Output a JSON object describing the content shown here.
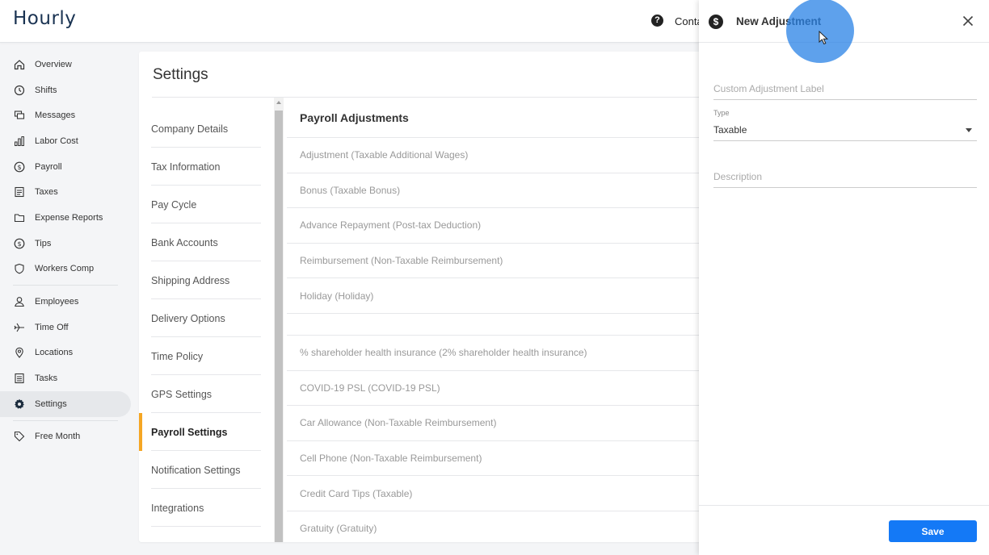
{
  "app": {
    "name": "Hourly"
  },
  "topbar": {
    "help_icon": "question-circle-icon",
    "contact_label": "Contact"
  },
  "nav": {
    "items": [
      {
        "label": "Overview",
        "icon": "home-icon"
      },
      {
        "label": "Shifts",
        "icon": "clock-icon"
      },
      {
        "label": "Messages",
        "icon": "chat-icon"
      },
      {
        "label": "Labor Cost",
        "icon": "bar-chart-icon"
      },
      {
        "label": "Payroll",
        "icon": "dollar-circle-icon"
      },
      {
        "label": "Taxes",
        "icon": "document-icon"
      },
      {
        "label": "Expense Reports",
        "icon": "folder-icon"
      },
      {
        "label": "Tips",
        "icon": "dollar-circle-icon"
      },
      {
        "label": "Workers Comp",
        "icon": "shield-icon"
      },
      {
        "label": "Employees",
        "icon": "person-icon"
      },
      {
        "label": "Time Off",
        "icon": "plane-icon"
      },
      {
        "label": "Locations",
        "icon": "location-pin-icon"
      },
      {
        "label": "Tasks",
        "icon": "list-icon"
      },
      {
        "label": "Settings",
        "icon": "gear-icon",
        "active": true
      },
      {
        "label": "Free Month",
        "icon": "tag-icon"
      }
    ]
  },
  "settings": {
    "title": "Settings",
    "subnav": [
      "Company Details",
      "Tax Information",
      "Pay Cycle",
      "Bank Accounts",
      "Shipping Address",
      "Delivery Options",
      "Time Policy",
      "GPS Settings",
      "Payroll Settings",
      "Notification Settings",
      "Integrations"
    ],
    "active_subnav": "Payroll Settings",
    "section_title": "Payroll Adjustments",
    "adjustments": [
      "Adjustment (Taxable Additional Wages)",
      "Bonus (Taxable Bonus)",
      "Advance Repayment (Post-tax Deduction)",
      "Reimbursement (Non-Taxable Reimbursement)",
      "Holiday (Holiday)",
      "",
      "% shareholder health insurance (2% shareholder health insurance)",
      "COVID-19 PSL (COVID-19 PSL)",
      "Car Allowance (Non-Taxable Reimbursement)",
      "Cell Phone (Non-Taxable Reimbursement)",
      "Credit Card Tips (Taxable)",
      "Gratuity (Gratuity)"
    ]
  },
  "panel": {
    "title": "New Adjustment",
    "icon": "dollar-circle-icon",
    "label_placeholder": "Custom Adjustment Label",
    "type_label": "Type",
    "type_value": "Taxable",
    "description_placeholder": "Description",
    "save_label": "Save"
  },
  "colors": {
    "accent": "#f5a623",
    "primary": "#1479f6",
    "brand": "#1a3352"
  }
}
